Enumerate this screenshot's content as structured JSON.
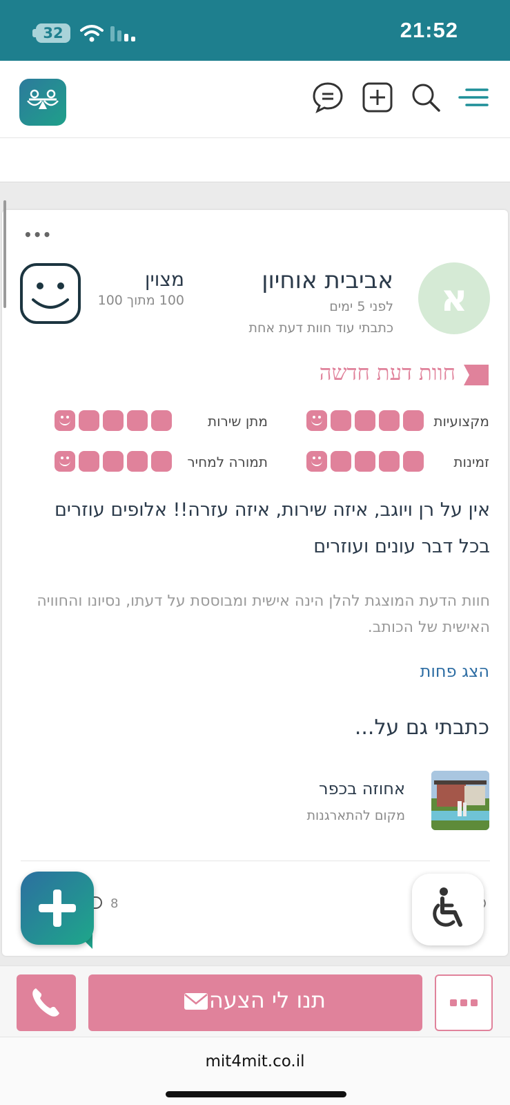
{
  "status_bar": {
    "time": "21:52",
    "battery": "32"
  },
  "header": {
    "logo_icon": "scales-logo-icon",
    "icons": [
      "chat-icon",
      "add-square-icon",
      "search-icon",
      "menu-icon"
    ]
  },
  "review": {
    "avatar_letter": "א",
    "author": "אביבית אוחיון",
    "posted": "לפני 5 ימים",
    "more_reviews": "כתבתי עוד חוות דעת אחת",
    "score_label": "מצוין",
    "score_sub": "100 מתוך 100",
    "section_title": "חוות דעת חדשה",
    "ratings": [
      {
        "label": "מקצועיות",
        "value": 5,
        "max": 5
      },
      {
        "label": "מתן שירות",
        "value": 5,
        "max": 5
      },
      {
        "label": "זמינות",
        "value": 5,
        "max": 5
      },
      {
        "label": "תמורה למחיר",
        "value": 5,
        "max": 5
      }
    ],
    "body": "אין על רן ויוגב, איזה שירות, איזה עזרה!! אלופים עוזרים בכל דבר עונים ועוזרים",
    "disclaimer": "חוות הדעת המוצגת להלן הינה אישית ומבוססת על דעתו, נסיונו והחוויה האישית של הכותב.",
    "show_less": "הצג פחות",
    "also_wrote_title": "כתבתי גם על...",
    "venue": {
      "name": "אחוזה בכפר",
      "type": "מקום להתארגנות"
    },
    "view_count": "8"
  },
  "actions": {
    "quote_label": "תנו לי הצעה",
    "call_icon": "phone-icon",
    "more_icon": "more-dots-icon"
  },
  "browser": {
    "url": "mit4mit.co.il"
  },
  "colors": {
    "brand_teal": "#1e7f8e",
    "accent_pink": "#e0829b"
  }
}
